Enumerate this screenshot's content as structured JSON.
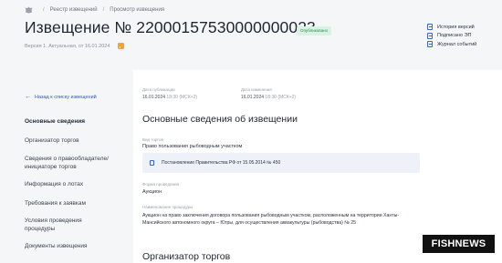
{
  "breadcrumbs": [
    "Реестр извещений",
    "Просмотр извещения"
  ],
  "notice": {
    "title": "Извещение № 22000157530000000023",
    "status": "Опубликовано",
    "version": "Версия 1. Актуальная, от 16.01.2024"
  },
  "actions": [
    "История версий",
    "Подписано ЭП",
    "Журнал событий"
  ],
  "sidebar": {
    "back": "Назад к списку извещений",
    "items": [
      "Основные сведения",
      "Организатор торгов",
      "Сведения о правообладателе/ инициаторе торгов",
      "Информация о лотах",
      "Требования к заявкам",
      "Условия проведения процедуры",
      "Документы извещения"
    ]
  },
  "meta": {
    "published_label": "Дата публикации",
    "published_date": "16.01.2024",
    "published_time": "18:30 (МСК+2)",
    "changed_label": "Дата изменения",
    "changed_date": "16.01.2024",
    "changed_time": "18:30 (МСК+2)"
  },
  "main": {
    "section_title": "Основные сведения об извещении",
    "bidding_type_label": "Вид торгов",
    "bidding_type": "Право пользования рыбоводным участком",
    "document": "Постановление Правительства РФ от 15.05.2014 № 450",
    "form_label": "Форма проведения",
    "form": "Аукцион",
    "procedure_label": "Наименование процедуры",
    "procedure": "Аукцион на право заключения договора пользования рыбоводным участком, расположенным на территории Ханты-Мансийского автономного округа – Югры, для осуществления аквакультуры (рыбоводства) № 25",
    "next_section_title": "Организатор торгов"
  },
  "watermark": {
    "part1": "FISH",
    "part2": "NEWS"
  }
}
